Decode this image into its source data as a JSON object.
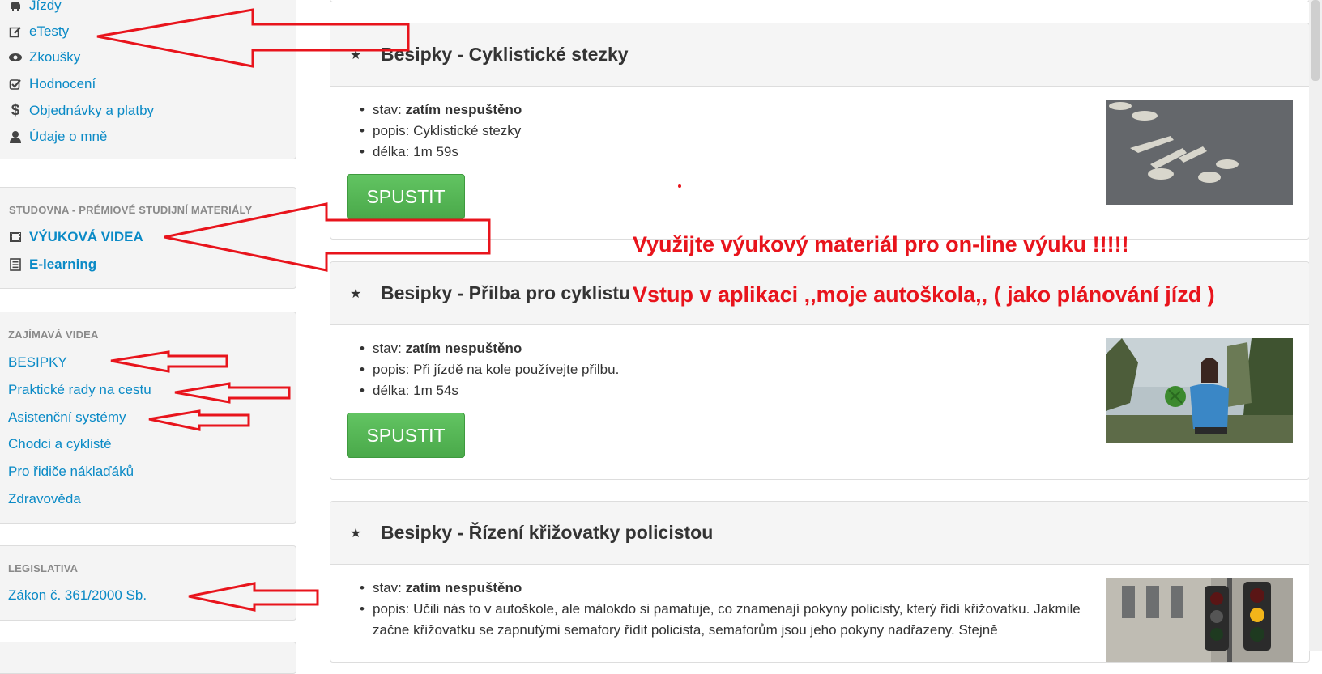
{
  "sidebar": {
    "menu": [
      {
        "label": "Jízdy",
        "icon": "car-icon"
      },
      {
        "label": "eTesty",
        "icon": "edit-icon"
      },
      {
        "label": "Zkoušky",
        "icon": "eye-icon"
      },
      {
        "label": "Hodnocení",
        "icon": "check-square-icon"
      },
      {
        "label": "Objednávky a platby",
        "icon": "dollar-icon"
      },
      {
        "label": "Údaje o mně",
        "icon": "user-icon"
      }
    ],
    "studovna": {
      "heading": "STUDOVNA - PRÉMIOVÉ STUDIJNÍ MATERIÁLY",
      "items": [
        {
          "label": "VÝUKOVÁ VIDEA",
          "icon": "film-icon"
        },
        {
          "label": "E-learning",
          "icon": "list-icon"
        }
      ]
    },
    "zajimava": {
      "heading": "ZAJÍMAVÁ VIDEA",
      "items": [
        "BESIPKY",
        "Praktické rady na cestu",
        "Asistenční systémy",
        "Chodci a cyklisté",
        "Pro řidiče náklaďáků",
        "Zdravověda"
      ]
    },
    "legislativa": {
      "heading": "LEGISLATIVA",
      "items": [
        "Zákon č. 361/2000 Sb."
      ]
    }
  },
  "videos": [
    {
      "title": "Besipky - Cyklistické stezky",
      "stav_label": "stav:",
      "stav_value": "zatím nespuštěno",
      "popis_label": "popis:",
      "popis_value": "Cyklistické stezky",
      "delka_label": "délka:",
      "delka_value": "1m 59s",
      "button": "SPUSTIT"
    },
    {
      "title": "Besipky - Přilba pro cyklistu",
      "stav_label": "stav:",
      "stav_value": "zatím nespuštěno",
      "popis_label": "popis:",
      "popis_value": "Při jízdě na kole používejte přilbu.",
      "delka_label": "délka:",
      "delka_value": "1m 54s",
      "button": "SPUSTIT"
    },
    {
      "title": "Besipky - Řízení křižovatky policistou",
      "stav_label": "stav:",
      "stav_value": "zatím nespuštěno",
      "popis_label": "popis:",
      "popis_value": "Učili nás to v autoškole, ale málokdo si pamatuje, co znamenají pokyny policisty, který řídí křižovatku. Jakmile začne křižovatku se zapnutými semafory řídit policista, semaforům jsou jeho pokyny nadřazeny. Stejně"
    }
  ],
  "annotations": {
    "line1": "Využijte výukový materiál pro on-line výuku !!!!!",
    "line2": "Vstup v aplikaci ,,moje autoškola,,   ( jako plánování jízd )"
  },
  "colors": {
    "link": "#0a8ac6",
    "annotation": "#e8141c",
    "button": "#5cb85c"
  }
}
